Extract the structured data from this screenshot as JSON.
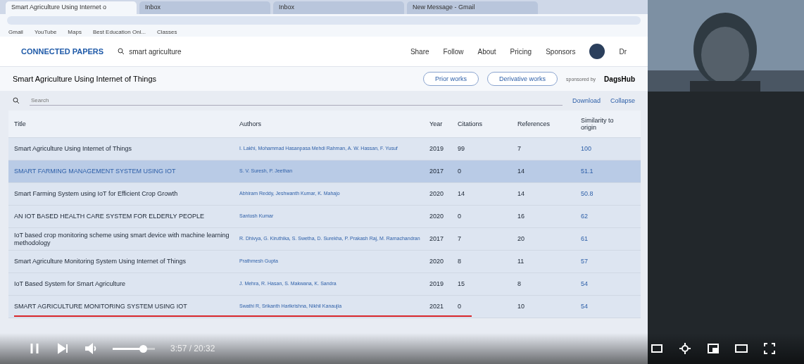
{
  "browser": {
    "tabs": [
      {
        "label": "Smart Agriculture Using Internet o",
        "selected": true
      },
      {
        "label": "Inbox",
        "selected": false
      },
      {
        "label": "Inbox",
        "selected": false
      },
      {
        "label": "New Message - Gmail",
        "selected": false
      }
    ],
    "bookmarks": [
      "Gmail",
      "YouTube",
      "Maps",
      "Best Education Onl...",
      "Classes"
    ]
  },
  "app": {
    "logo": "CONNECTED PAPERS",
    "search": "smart agriculture",
    "nav": [
      "Share",
      "Follow",
      "About",
      "Pricing",
      "Sponsors"
    ],
    "user": "Dr"
  },
  "graph_bar": {
    "title": "Smart Agriculture Using Internet of Things",
    "buttons": [
      "Prior works",
      "Derivative works"
    ],
    "sponsor_label": "sponsored by",
    "sponsor": "DagsHub"
  },
  "table": {
    "filter_placeholder": "Search",
    "actions": [
      "Download",
      "Collapse"
    ],
    "columns": [
      "Title",
      "Authors",
      "Year",
      "Citations",
      "References",
      "Similarity to origin"
    ],
    "rows": [
      {
        "cells": [
          "Smart Agriculture Using Internet of Things",
          "I. Lakhi, Mohammad Hasanpasa Mehdi Rahman, A. W. Hassan, F. Yusuf",
          "2019",
          "99",
          "7",
          "100"
        ],
        "selected": false,
        "underlined": false
      },
      {
        "cells": [
          "SMART FARMING MANAGEMENT SYSTEM USING IOT",
          "S. V. Suresh, P. Jeethan",
          "2017",
          "0",
          "14",
          "51.1"
        ],
        "selected": true,
        "underlined": false
      },
      {
        "cells": [
          "Smart Farming System using IoT for Efficient Crop Growth",
          "Abhiram Reddy, Jeshwanth Kumar, K. Mahajo",
          "2020",
          "14",
          "14",
          "50.8"
        ],
        "selected": false,
        "underlined": false
      },
      {
        "cells": [
          "AN IOT BASED HEALTH CARE SYSTEM FOR ELDERLY PEOPLE",
          "Santosh Kumar",
          "2020",
          "0",
          "16",
          "62"
        ],
        "selected": false,
        "underlined": false
      },
      {
        "cells": [
          "IoT based crop monitoring scheme using smart device with machine learning methodology",
          "R. Dhivya, G. Kiruthika, S. Swetha, D. Surekha, P. Prakash Raj, M. Ramachandran",
          "2017",
          "7",
          "20",
          "61"
        ],
        "selected": false,
        "underlined": false
      },
      {
        "cells": [
          "Smart Agriculture Monitoring System Using Internet of Things",
          "Prathmesh Gupta",
          "2020",
          "8",
          "11",
          "57"
        ],
        "selected": false,
        "underlined": false
      },
      {
        "cells": [
          "IoT Based System for Smart Agriculture",
          "J. Mehra, R. Hasan, S. Makwana, K. Sandra",
          "2019",
          "15",
          "8",
          "54"
        ],
        "selected": false,
        "underlined": false
      },
      {
        "cells": [
          "SMART AGRICULTURE MONITORING SYSTEM USING IOT",
          "Swathi R, Srikanth Harikrishna, Nikhil Kanaujia",
          "2021",
          "0",
          "10",
          "54"
        ],
        "selected": false,
        "underlined": true
      }
    ]
  },
  "player": {
    "playing": true,
    "volume": {
      "level": 0.72
    },
    "time": "3:57 / 20:32"
  }
}
